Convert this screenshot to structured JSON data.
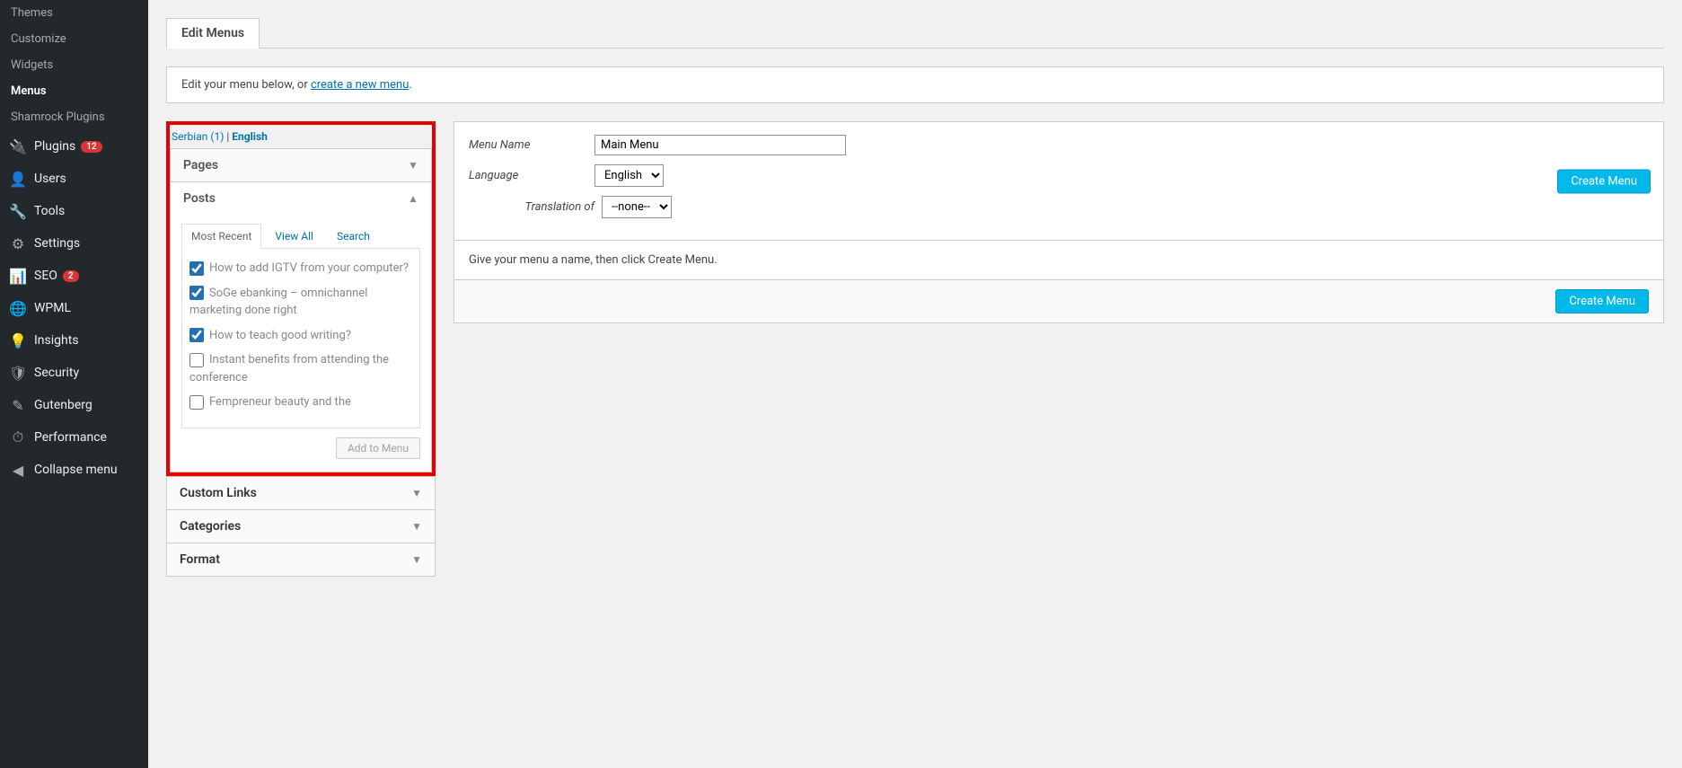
{
  "sidebar": {
    "appearance_sub": [
      {
        "label": "Themes",
        "active": false
      },
      {
        "label": "Customize",
        "active": false
      },
      {
        "label": "Widgets",
        "active": false
      },
      {
        "label": "Menus",
        "active": true
      },
      {
        "label": "Shamrock Plugins",
        "active": false
      }
    ],
    "items": [
      {
        "icon": "🔌",
        "label": "Plugins",
        "badge": "12"
      },
      {
        "icon": "👤",
        "label": "Users",
        "badge": null
      },
      {
        "icon": "🔧",
        "label": "Tools",
        "badge": null
      },
      {
        "icon": "⚙",
        "label": "Settings",
        "badge": null
      },
      {
        "icon": "📊",
        "label": "SEO",
        "badge": "2"
      },
      {
        "icon": "🌐",
        "label": "WPML",
        "badge": null
      },
      {
        "icon": "💡",
        "label": "Insights",
        "badge": null
      },
      {
        "icon": "🛡",
        "label": "Security",
        "badge": null
      },
      {
        "icon": "✎",
        "label": "Gutenberg",
        "badge": null
      },
      {
        "icon": "⏱",
        "label": "Performance",
        "badge": null
      },
      {
        "icon": "◀",
        "label": "Collapse menu",
        "badge": null
      }
    ]
  },
  "tab_label": "Edit Menus",
  "info_prefix": "Edit your menu below, or ",
  "info_link": "create a new menu",
  "lang": {
    "a": "Serbian (1)",
    "sep": " | ",
    "b": "English"
  },
  "acc": {
    "pages": "Pages",
    "posts": "Posts",
    "custom": "Custom Links",
    "categories": "Categories",
    "format": "Format"
  },
  "post_tabs": {
    "recent": "Most Recent",
    "viewall": "View All",
    "search": "Search"
  },
  "posts": [
    {
      "checked": true,
      "label": "How to add IGTV from your computer?"
    },
    {
      "checked": true,
      "label": "SoGe ebanking – omnichannel marketing done right"
    },
    {
      "checked": true,
      "label": "How to teach good writing?"
    },
    {
      "checked": false,
      "label": "Instant benefits from attending the conference"
    },
    {
      "checked": false,
      "label": "Fempreneur beauty and the"
    }
  ],
  "add_btn": "Add to Menu",
  "form": {
    "menu_name_label": "Menu Name",
    "menu_name_value": "Main Menu",
    "language_label": "Language",
    "language_value": "English",
    "translation_label": "Translation of",
    "translation_value": "--none--",
    "create_btn": "Create Menu",
    "notice": "Give your menu a name, then click Create Menu."
  }
}
